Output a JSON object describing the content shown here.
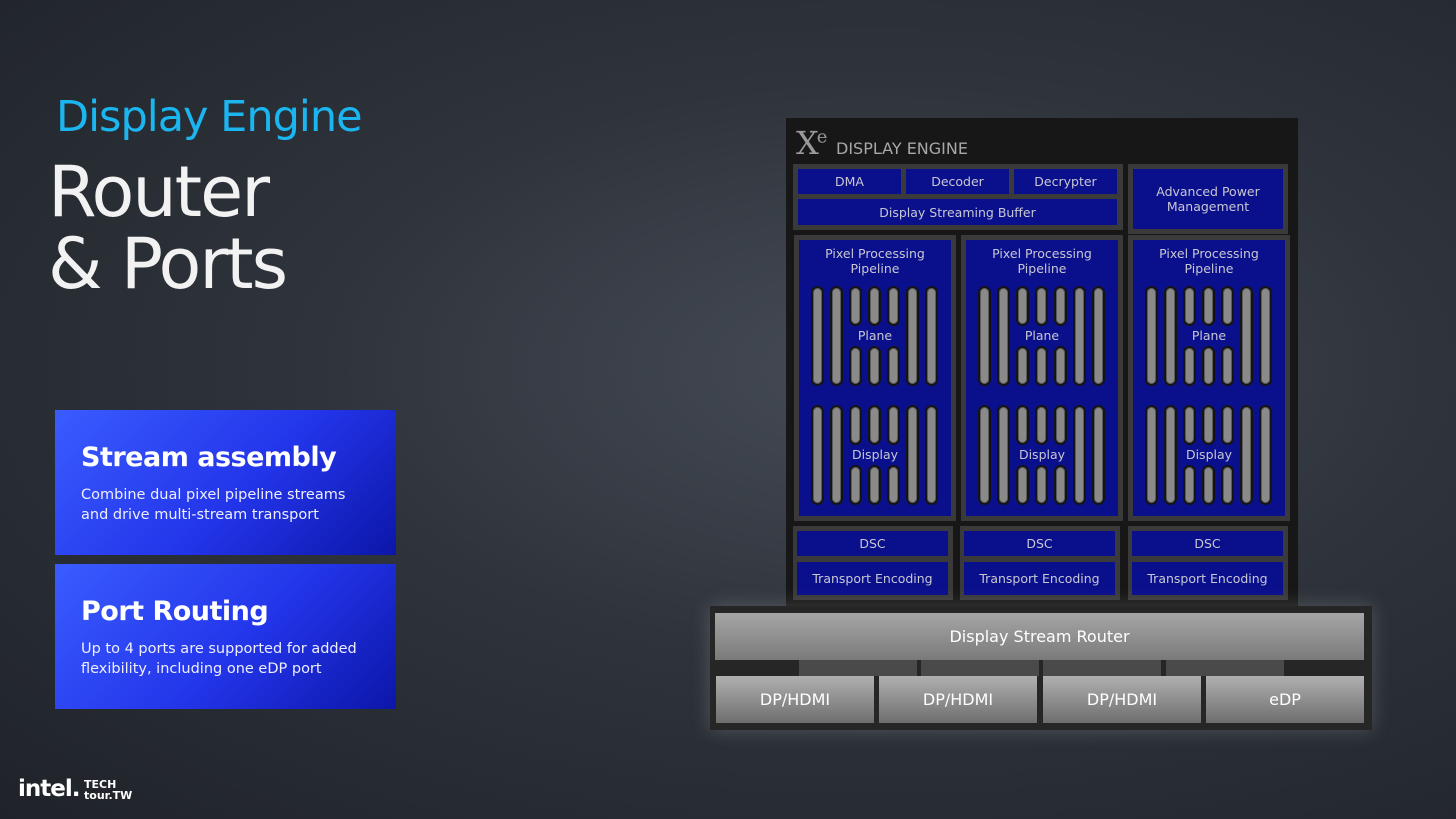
{
  "slide": {
    "kicker": "Display Engine",
    "headline_line1": "Router",
    "headline_line2": "& Ports"
  },
  "cards": [
    {
      "title": "Stream assembly",
      "text": "Combine dual pixel pipeline streams and drive multi-stream transport"
    },
    {
      "title": "Port Routing",
      "text": "Up to 4 ports are supported for added flexibility, including one eDP port"
    }
  ],
  "footer": {
    "intel": "intel.",
    "tech_line1": "TECH",
    "tech_line2": "tour.TW"
  },
  "diagram": {
    "logo_x": "X",
    "logo_e": "e",
    "engine_title": "DISPLAY ENGINE",
    "top_blocks": [
      "DMA",
      "Decoder",
      "Decrypter"
    ],
    "streaming_buffer": "Display Streaming Buffer",
    "power_mgmt": "Advanced Power Management",
    "pipelines": [
      {
        "title": "Pixel Processing Pipeline",
        "plane": "Plane",
        "display": "Display",
        "dsc": "DSC",
        "transport": "Transport Encoding"
      },
      {
        "title": "Pixel Processing Pipeline",
        "plane": "Plane",
        "display": "Display",
        "dsc": "DSC",
        "transport": "Transport Encoding"
      },
      {
        "title": "Pixel Processing Pipeline",
        "plane": "Plane",
        "display": "Display",
        "dsc": "DSC",
        "transport": "Transport Encoding"
      }
    ],
    "router": "Display Stream Router",
    "ports": [
      "DP/HDMI",
      "DP/HDMI",
      "DP/HDMI",
      "eDP"
    ]
  }
}
